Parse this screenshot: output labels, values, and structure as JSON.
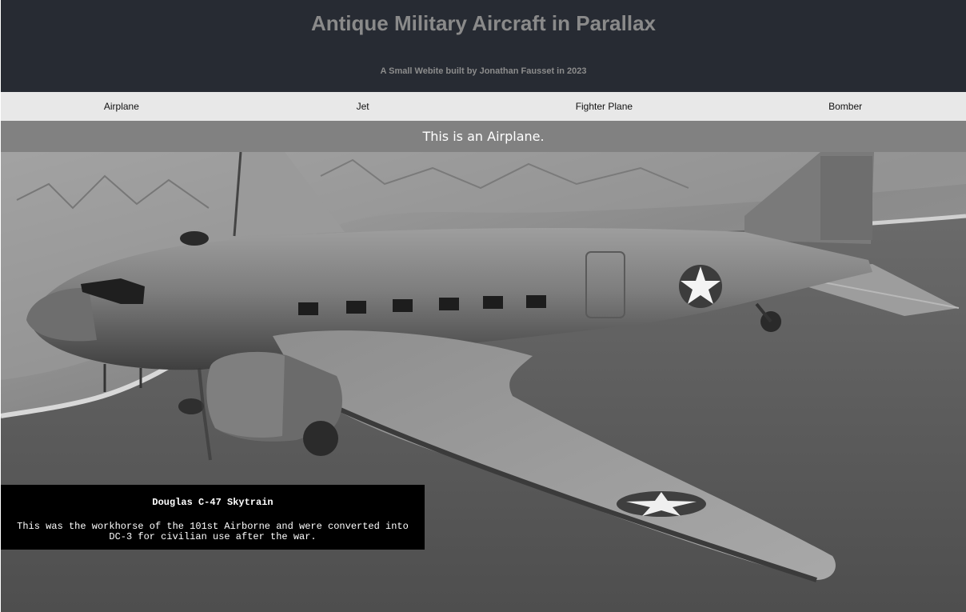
{
  "header": {
    "title": "Antique Military Aircraft in Parallax",
    "subtitle": "A Small Webite built by Jonathan Fausset in 2023"
  },
  "nav": {
    "items": [
      {
        "label": "Airplane"
      },
      {
        "label": "Jet"
      },
      {
        "label": "Fighter Plane"
      },
      {
        "label": "Bomber"
      }
    ]
  },
  "section": {
    "banner": "This is an Airplane."
  },
  "hero": {
    "image_subject": "Douglas C-47 Skytrain in flight over coastline (black and white photo)",
    "caption_title": "Douglas C-47 Skytrain",
    "caption_text": "This was the workhorse of the 101st Airborne and were converted into DC-3 for civilian use after the war."
  },
  "colors": {
    "header_bg": "#272b33",
    "nav_bg": "#e8e8e8",
    "banner_bg": "#818181",
    "caption_bg": "#000000"
  }
}
